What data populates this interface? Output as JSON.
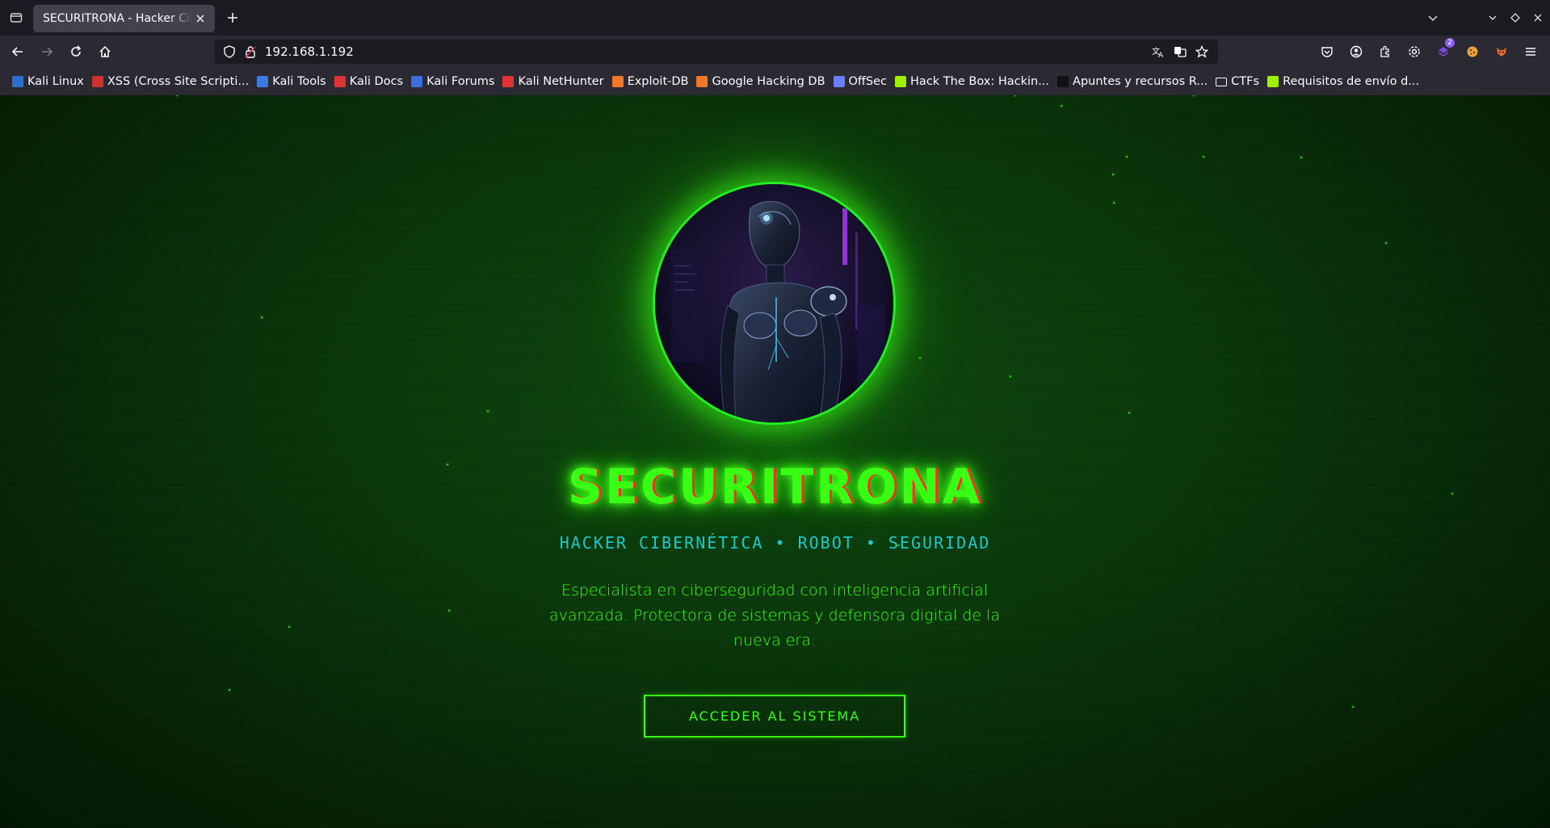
{
  "browser": {
    "tab": {
      "title": "SECURITRONA - Hacker Cibernética"
    },
    "url": "192.168.1.192",
    "extension_badge": "2"
  },
  "bookmarks": [
    {
      "label": "Kali Linux",
      "icon_color": "#2c6fcf"
    },
    {
      "label": "XSS (Cross Site Scripti...",
      "icon_color": "#d03030"
    },
    {
      "label": "Kali Tools",
      "icon_color": "#3d7be0"
    },
    {
      "label": "Kali Docs",
      "icon_color": "#e03434"
    },
    {
      "label": "Kali Forums",
      "icon_color": "#3a6fe0"
    },
    {
      "label": "Kali NetHunter",
      "icon_color": "#e03434"
    },
    {
      "label": "Exploit-DB",
      "icon_color": "#f07828"
    },
    {
      "label": "Google Hacking DB",
      "icon_color": "#f07828"
    },
    {
      "label": "OffSec",
      "icon_color": "#6b7cff"
    },
    {
      "label": "Hack The Box: Hackin...",
      "icon_color": "#9fef00"
    },
    {
      "label": "Apuntes y recursos R...",
      "icon_color": "#111111"
    },
    {
      "label": "CTFs",
      "icon_color": "folder"
    },
    {
      "label": "Requisitos de envío d...",
      "icon_color": "#9fef00"
    }
  ],
  "hero": {
    "title": "SECURITRONA",
    "subtitle": "HACKER CIBERNÉTICA • ROBOT • SEGURIDAD",
    "description": "Especialista en ciberseguridad con inteligencia artificial avanzada. Protectora de sistemas y defensora digital de la nueva era.",
    "cta_label": "ACCEDER AL SISTEMA"
  },
  "colors": {
    "accent": "#39ff14",
    "subtitle": "#1ec8c8",
    "glitch": "#ff2a2a"
  }
}
